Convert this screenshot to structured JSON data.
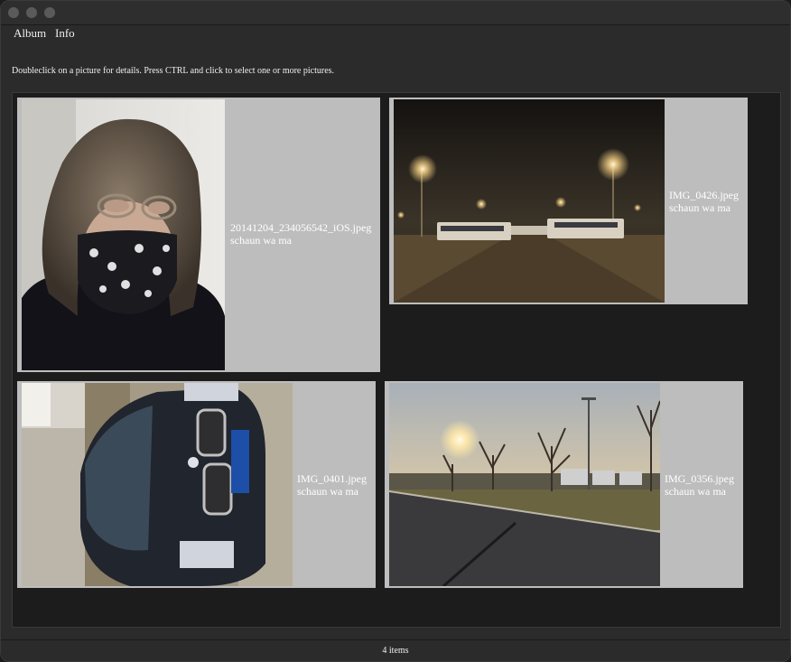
{
  "menu": {
    "album_label": "Album",
    "info_label": "Info"
  },
  "instructions": "Doubleclick on a picture for details. Press CTRL and click to select one or more pictures.",
  "photos": [
    {
      "filename": "20141204_234056542_iOS.jpeg",
      "author": "schaun wa ma"
    },
    {
      "filename": "IMG_0426.jpeg",
      "author": "schaun wa ma"
    },
    {
      "filename": "IMG_0401.jpeg",
      "author": "schaun wa ma"
    },
    {
      "filename": "IMG_0356.jpeg",
      "author": "schaun wa ma"
    }
  ],
  "status": {
    "item_count": "4 items"
  },
  "colors": {
    "card_bg": "#bdbdbd",
    "gallery_bg": "#1c1c1c",
    "window_bg": "#2b2b2b"
  }
}
